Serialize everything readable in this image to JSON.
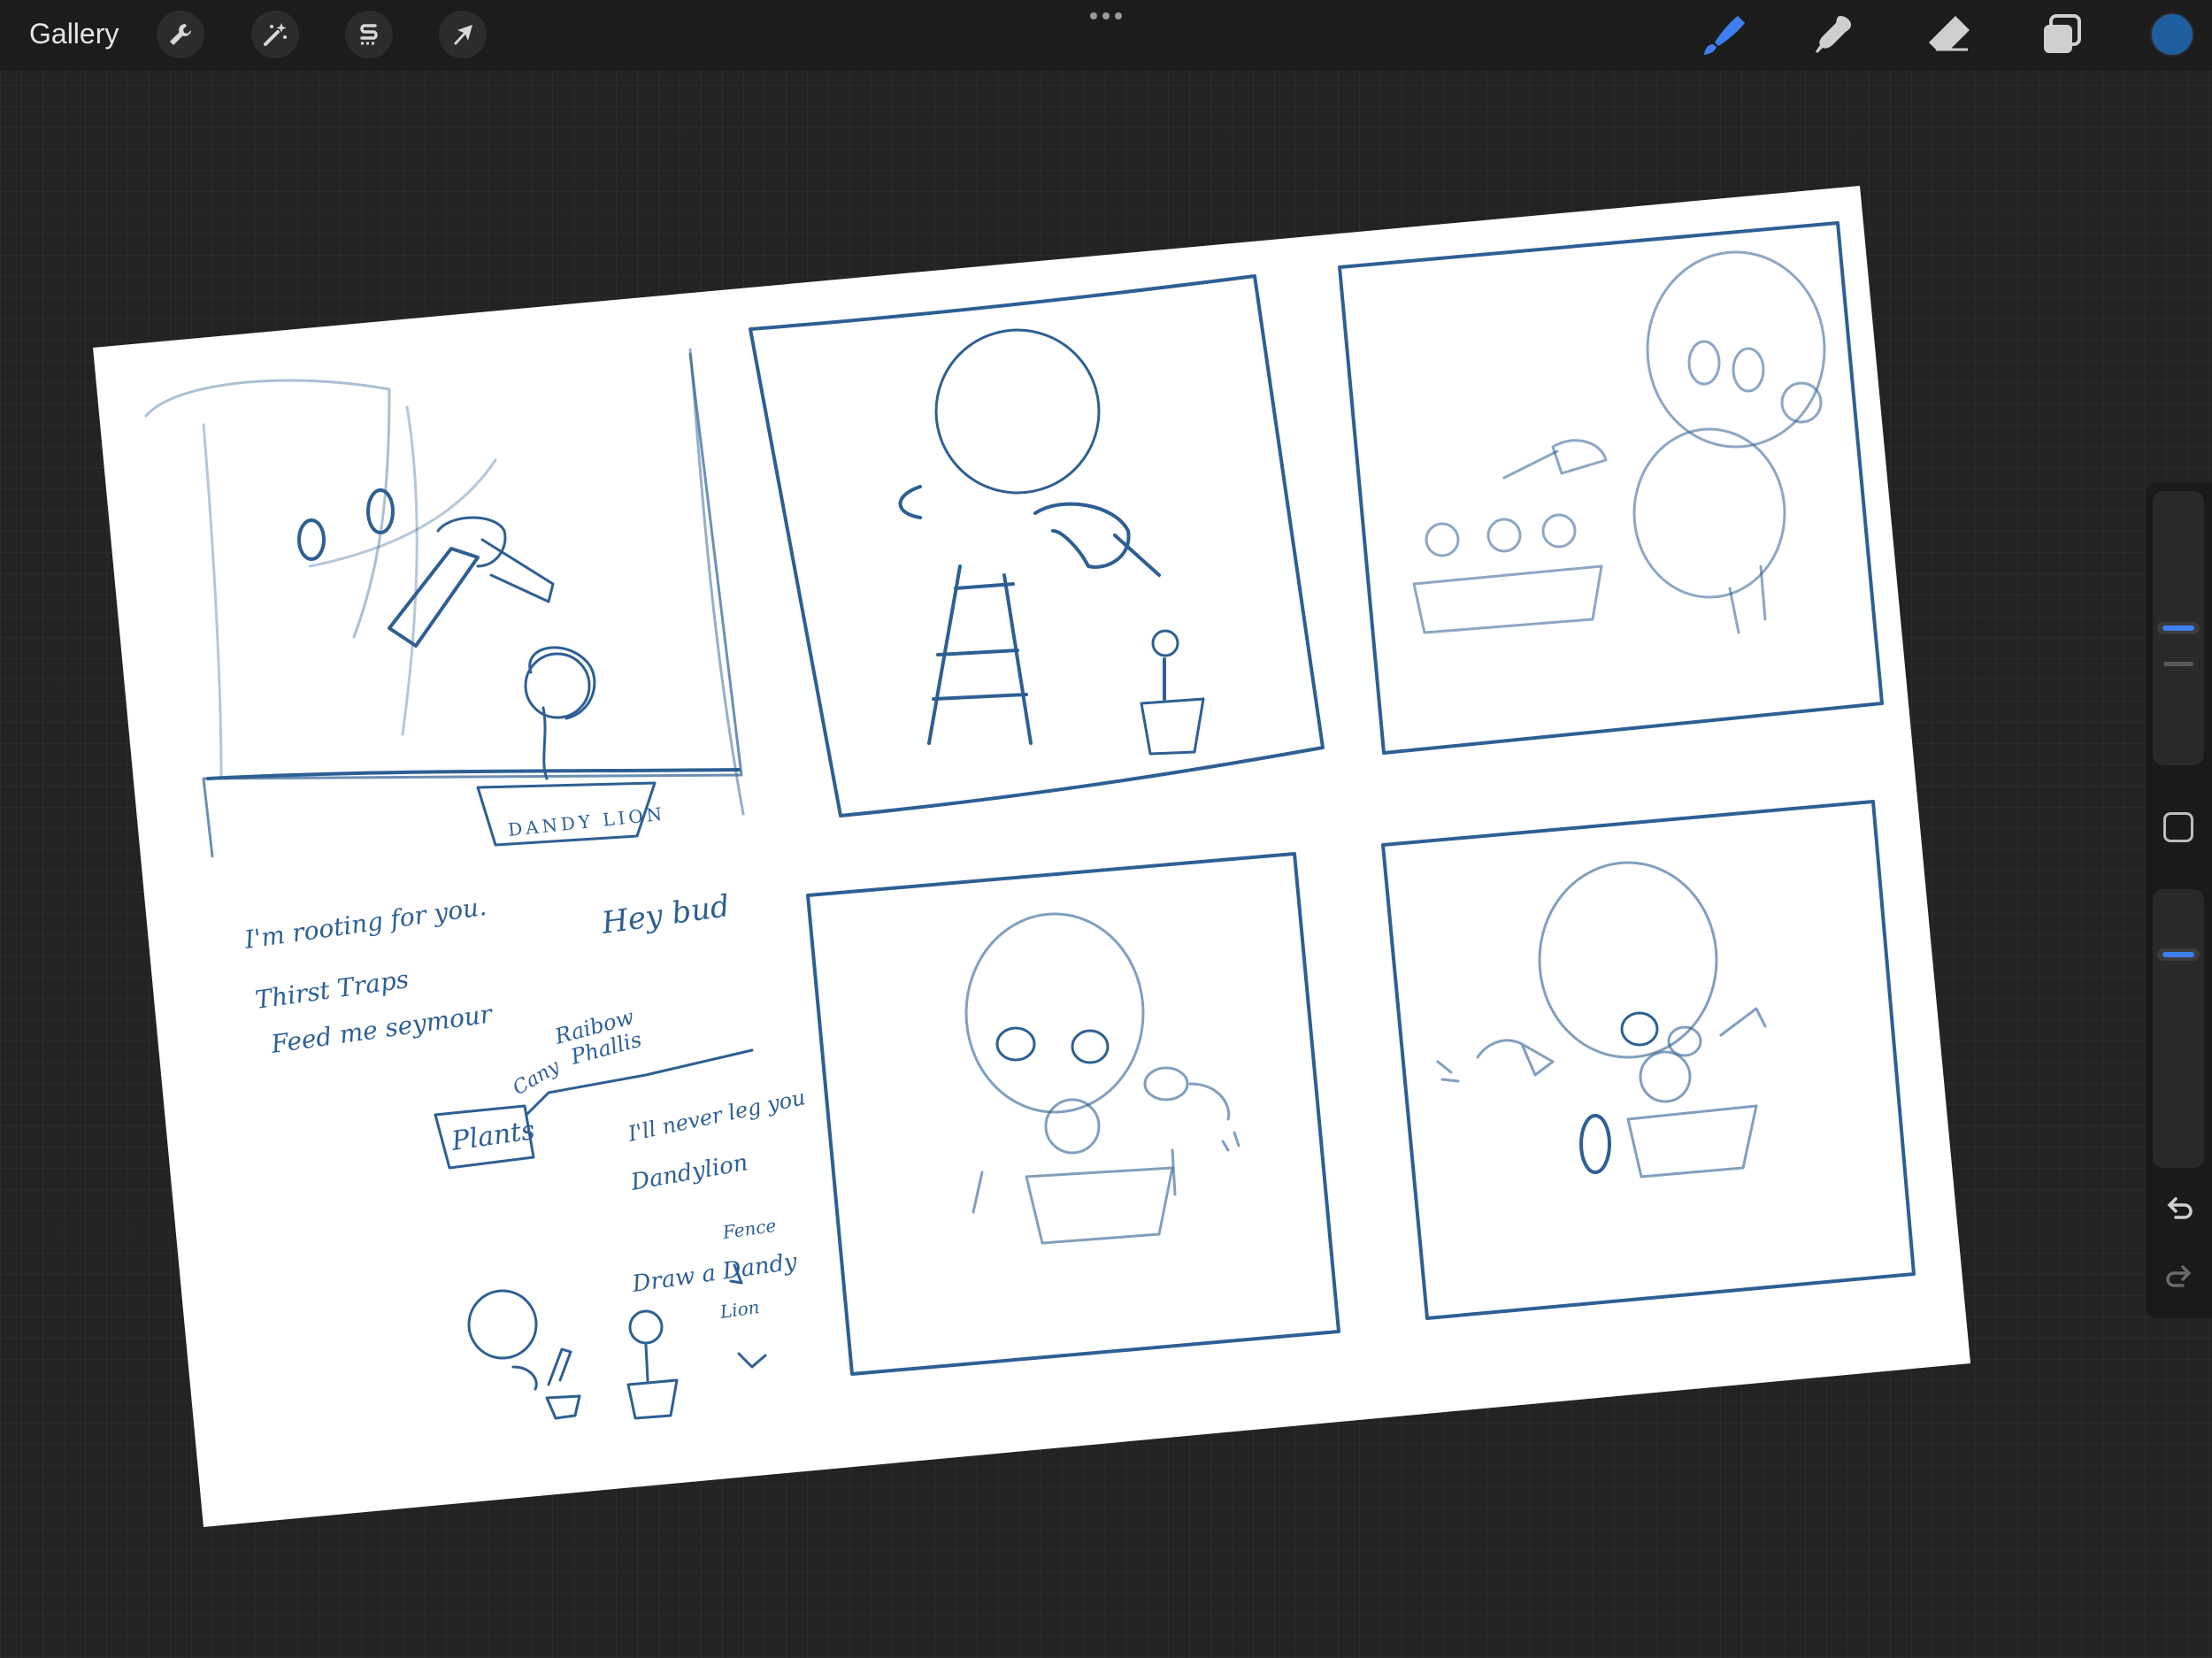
{
  "toolbar": {
    "gallery_label": "Gallery",
    "left_tools": [
      "wrench-icon",
      "magic-wand-icon",
      "selection-s-icon",
      "arrow-cursor-icon"
    ],
    "right_tools": [
      "brush-icon",
      "smudge-icon",
      "eraser-icon",
      "layers-icon"
    ],
    "active_tool": "brush-icon",
    "accent_color": "#3d7ff0",
    "current_color": "#1f5e9e"
  },
  "sidebar": {
    "brush_size_thumb": "size-slider",
    "opacity_thumb": "opacity-slider",
    "modify_button": "modify-square-button",
    "undo": "undo-icon",
    "redo": "redo-icon"
  },
  "artwork": {
    "paper_color": "#ffffff",
    "ink_color": "#2d5f93",
    "notes": {
      "n1": "I'm rooting for you.",
      "n2": "Thirst Traps",
      "n3": "Feed me seymour",
      "n4": "Hey bud",
      "n5": "Plants",
      "n6": "Cany",
      "n7": "Raibow",
      "n8": "Phallis",
      "n9": "I'll never leg you",
      "n10": "Dandylion",
      "n11": "Fence",
      "n12": "Draw a Dandy",
      "n13": "Lion",
      "pot_label": "DANDY LION"
    }
  }
}
